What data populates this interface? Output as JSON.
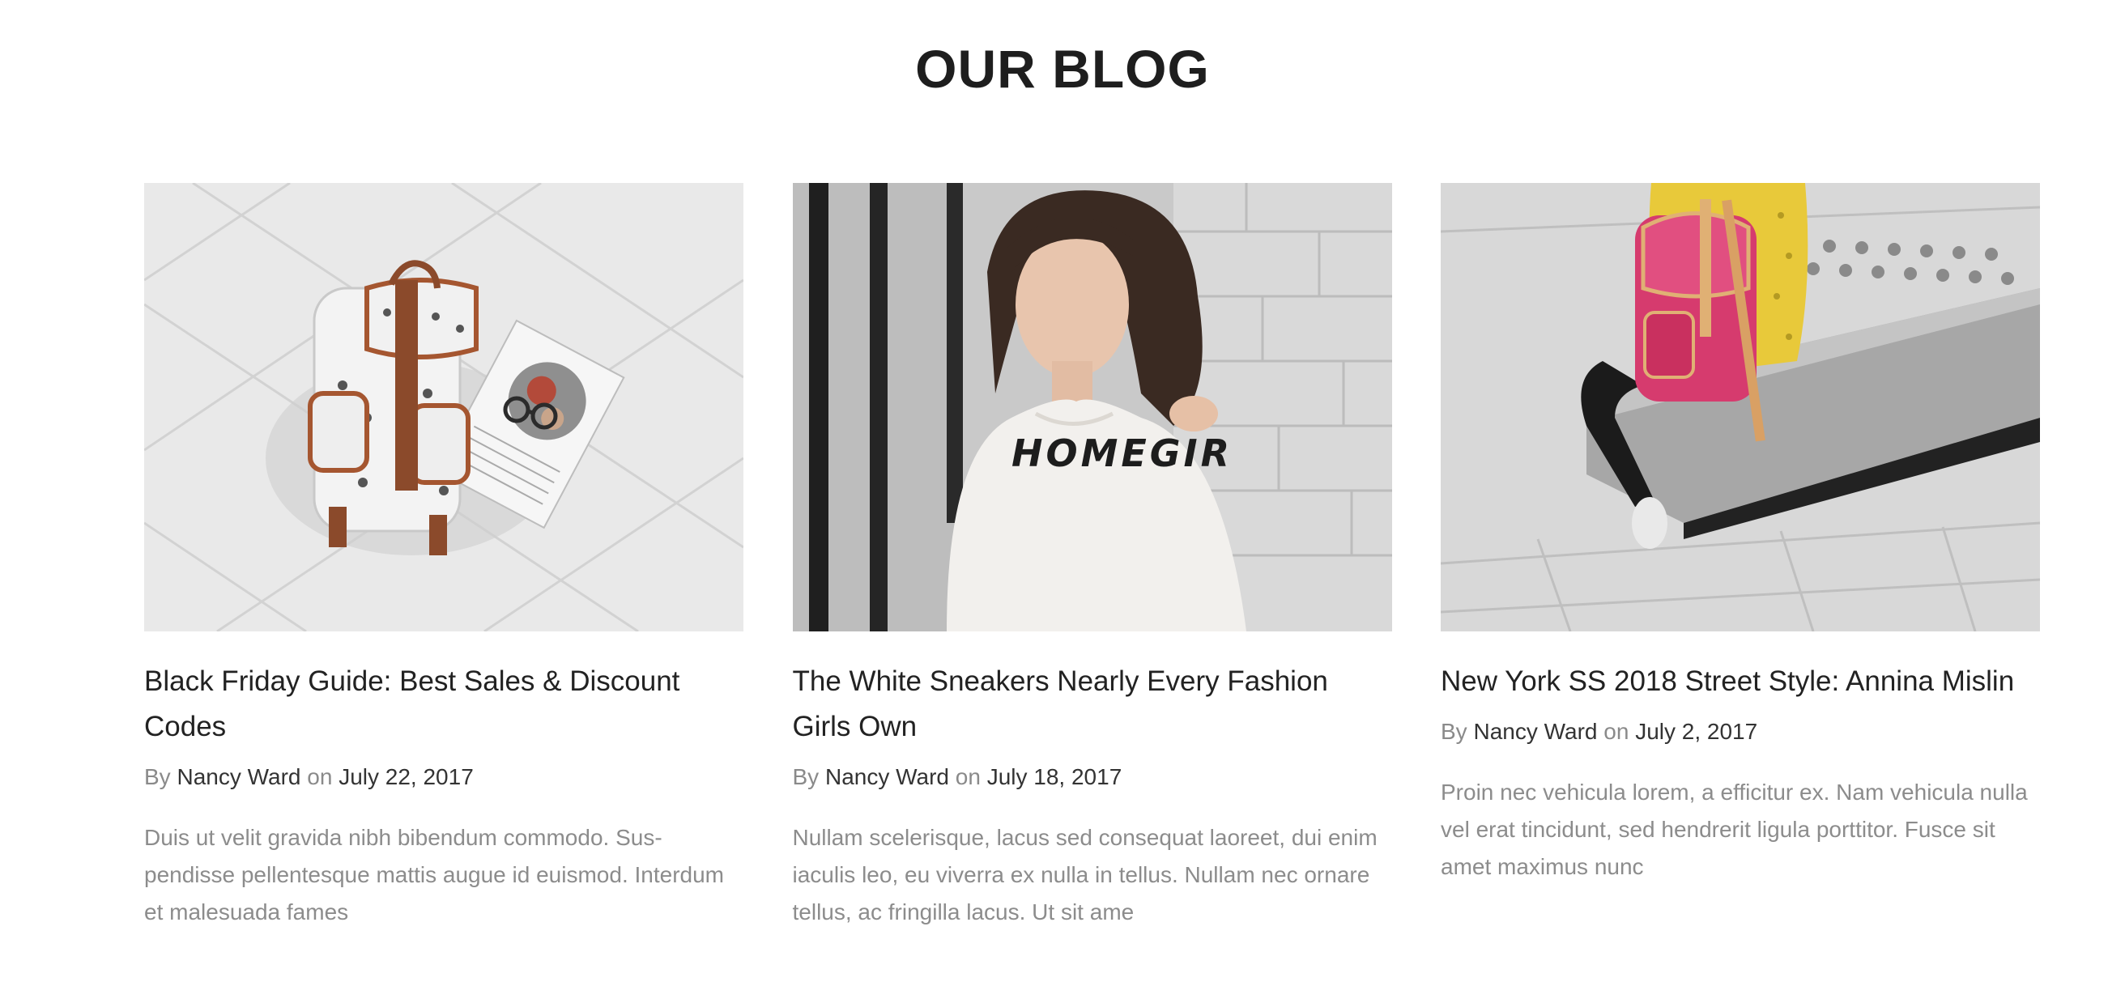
{
  "section": {
    "title": "OUR BLOG"
  },
  "posts": [
    {
      "title": "Black Friday Guide: Best Sales & Discount Codes",
      "by_label": "By",
      "author": "Nancy Ward",
      "on_label": "on",
      "date": "July 22, 2017",
      "excerpt": "Duis ut velit gravida nibh bibendum commodo. Sus­pendisse pellentesque mattis augue id euismod. Inter­dum et malesuada fames",
      "image_alt": "Patterned backpack with glasses and magazine on white quilted bedding"
    },
    {
      "title": "The White Sneakers Nearly Every Fashion Girls Own",
      "by_label": "By",
      "author": "Nancy Ward",
      "on_label": "on",
      "date": "July 18, 2017",
      "excerpt": "Nullam scelerisque, lacus sed consequat laoreet, dui enim iaculis leo, eu viverra ex nulla in tellus. Nullam nec ornare tellus, ac fringilla lacus. Ut sit ame",
      "image_alt": "Woman in white HOMEGIRL sweatshirt against a brick wall",
      "image_text": "HOMEGIR"
    },
    {
      "title": "New York SS 2018 Street Style: Annina Mislin",
      "by_label": "By",
      "author": "Nancy Ward",
      "on_label": "on",
      "date": "July 2, 2017",
      "excerpt": "Proin nec vehicula lorem, a efficitur ex. Nam vehicula nulla vel erat tincidunt, sed hendrerit ligula porttitor. Fusce sit amet maximus nunc",
      "image_alt": "Person with pink backpack sitting on a concrete block"
    }
  ],
  "colors": {
    "title": "#1e1e1e",
    "text": "#222222",
    "muted": "#8a8a8a",
    "excerpt": "#8c8c8c",
    "backpack_strap": "#8b4a2b",
    "pink_backpack": "#d63b6e",
    "yellow_top": "#e8c93a"
  }
}
